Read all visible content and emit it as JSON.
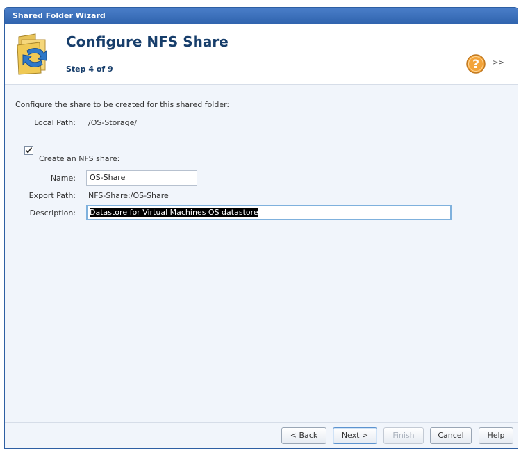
{
  "window": {
    "title": "Shared Folder Wizard"
  },
  "header": {
    "title": "Configure NFS Share",
    "step": "Step 4 of 9",
    "more_label": ">>"
  },
  "content": {
    "intro": "Configure the share to be created for this shared folder:",
    "local_path_label": "Local Path:",
    "local_path_value": "/OS-Storage/",
    "create_nfs_label": "Create an NFS share:",
    "create_nfs_checked": true,
    "name_label": "Name:",
    "name_value": "OS-Share",
    "export_path_label": "Export Path:",
    "export_path_value": "NFS-Share:/OS-Share",
    "description_label": "Description:",
    "description_value": "Datastore for Virtual Machines OS datastore"
  },
  "buttons": {
    "back": "< Back",
    "next": "Next >",
    "finish": "Finish",
    "cancel": "Cancel",
    "help": "Help"
  },
  "colors": {
    "titlebar": "#3a6fbb",
    "heading": "#173e6b",
    "content_bg": "#f1f5fb"
  }
}
